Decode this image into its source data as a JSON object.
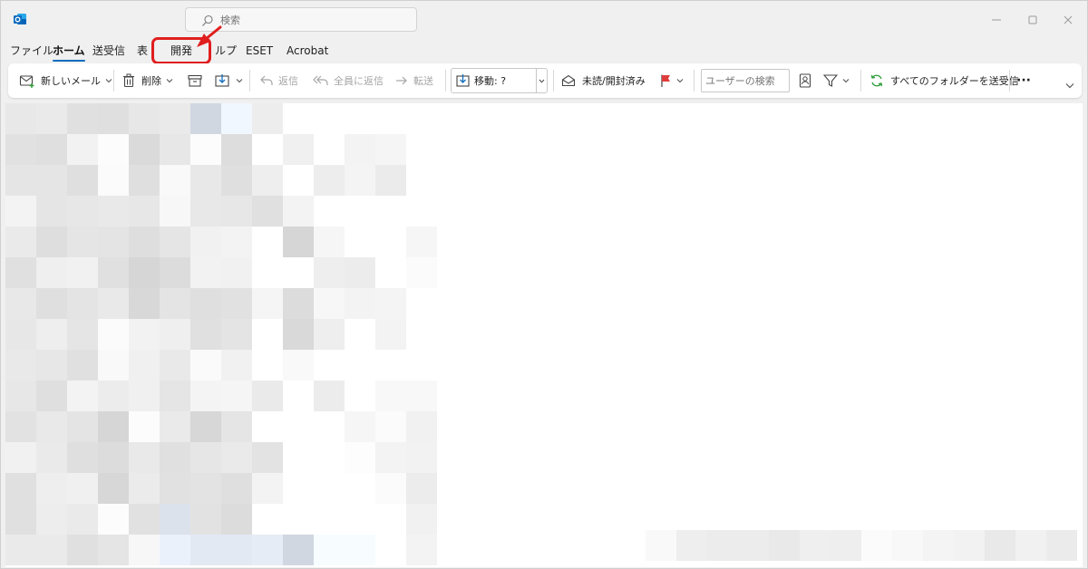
{
  "titlebar": {
    "search_placeholder": "検索"
  },
  "menu": {
    "tabs": [
      {
        "label": "ファイル"
      },
      {
        "label": "ホーム"
      },
      {
        "label": "送受信"
      },
      {
        "label": "表"
      },
      {
        "label": "開発"
      },
      {
        "label": "ルプ"
      },
      {
        "label": "ESET"
      },
      {
        "label": "Acrobat"
      }
    ]
  },
  "ribbon": {
    "new_mail": "新しいメール",
    "delete": "削除",
    "reply": "返信",
    "reply_all": "全員に返信",
    "forward": "転送",
    "move": "移動: ?",
    "unread_read": "未読/開封済み",
    "user_search_placeholder": "ユーザーの検索",
    "send_receive_all": "すべてのフォルダーを送受信",
    "more": "···"
  },
  "colors": {
    "accent": "#0f6cbd",
    "highlight": "#e01e1e",
    "flag": "#e03c3c"
  }
}
